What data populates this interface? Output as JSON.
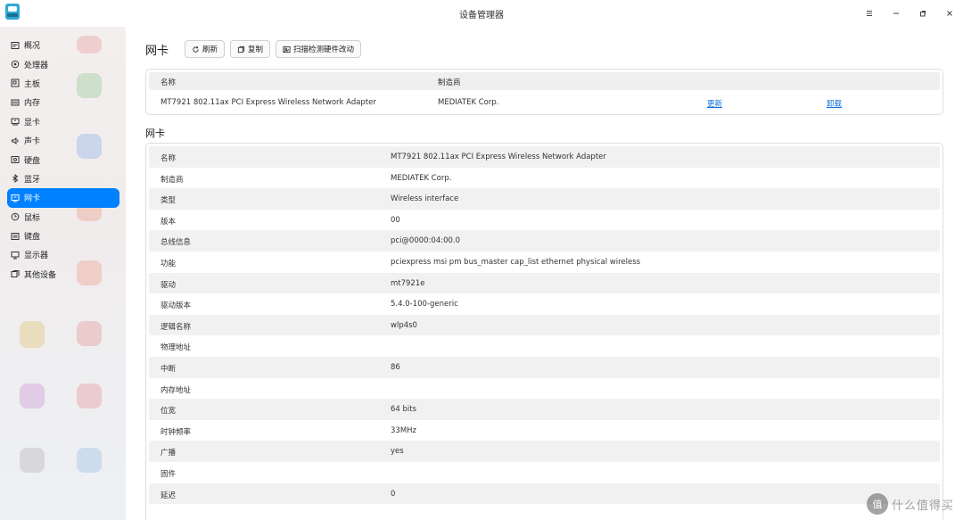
{
  "window": {
    "title": "设备管理器"
  },
  "sidebar": {
    "items": [
      {
        "label": "概况",
        "icon": "overview-icon"
      },
      {
        "label": "处理器",
        "icon": "cpu-icon"
      },
      {
        "label": "主板",
        "icon": "motherboard-icon"
      },
      {
        "label": "内存",
        "icon": "memory-icon"
      },
      {
        "label": "显卡",
        "icon": "gpu-icon"
      },
      {
        "label": "声卡",
        "icon": "sound-icon"
      },
      {
        "label": "硬盘",
        "icon": "disk-icon"
      },
      {
        "label": "蓝牙",
        "icon": "bluetooth-icon"
      },
      {
        "label": "网卡",
        "icon": "network-card-icon",
        "active": true
      },
      {
        "label": "鼠标",
        "icon": "mouse-icon"
      },
      {
        "label": "键盘",
        "icon": "keyboard-icon"
      },
      {
        "label": "显示器",
        "icon": "monitor-icon"
      },
      {
        "label": "其他设备",
        "icon": "other-devices-icon"
      }
    ]
  },
  "toolbar": {
    "title": "网卡",
    "refresh_label": "刷新",
    "copy_label": "复制",
    "scan_label": "扫描检测硬件改动"
  },
  "device_table": {
    "headers": {
      "name": "名称",
      "vendor": "制造商"
    },
    "rows": [
      {
        "name": "MT7921 802.11ax PCI Express Wireless Network Adapter",
        "vendor": "MEDIATEK Corp.",
        "update": "更新",
        "uninstall": "卸载"
      }
    ]
  },
  "details": {
    "title": "网卡",
    "rows": [
      {
        "key": "名称",
        "value": "MT7921 802.11ax PCI Express Wireless Network Adapter"
      },
      {
        "key": "制造商",
        "value": "MEDIATEK Corp."
      },
      {
        "key": "类型",
        "value": "Wireless interface"
      },
      {
        "key": "版本",
        "value": "00"
      },
      {
        "key": "总线信息",
        "value": "pci@0000:04:00.0"
      },
      {
        "key": "功能",
        "value": "pciexpress msi pm bus_master cap_list ethernet physical wireless"
      },
      {
        "key": "驱动",
        "value": "mt7921e"
      },
      {
        "key": "驱动版本",
        "value": "5.4.0-100-generic"
      },
      {
        "key": "逻辑名称",
        "value": "wlp4s0"
      },
      {
        "key": "物理地址",
        "value": ""
      },
      {
        "key": "中断",
        "value": "86"
      },
      {
        "key": "内存地址",
        "value": ""
      },
      {
        "key": "位宽",
        "value": "64 bits"
      },
      {
        "key": "时钟频率",
        "value": "33MHz"
      },
      {
        "key": "广播",
        "value": "yes"
      },
      {
        "key": "固件",
        "value": ""
      },
      {
        "key": "延迟",
        "value": "0"
      }
    ]
  },
  "watermark": {
    "logo": "值",
    "text": "什么值得买"
  },
  "colors": {
    "accent": "#0081ff",
    "link": "#0d6edc",
    "row_alt": "#f1f1f1"
  }
}
